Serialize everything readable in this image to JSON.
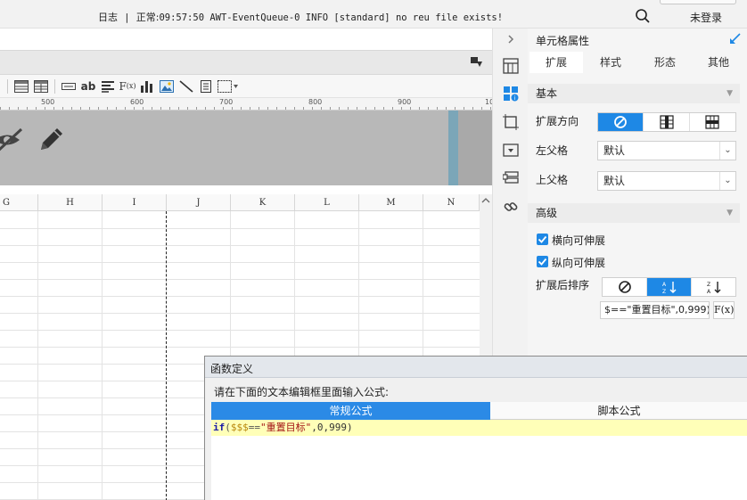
{
  "status": {
    "log_label": "日志",
    "separator": "|",
    "status_prefix": "正常:",
    "message": "09:57:50 AWT-EventQueue-0 INFO [standard] no reu file exists!"
  },
  "header": {
    "login_label": "未登录"
  },
  "ruler": {
    "labels": [
      "500",
      "600",
      "700",
      "800",
      "900",
      "10"
    ]
  },
  "grid": {
    "columns": [
      "G",
      "H",
      "I",
      "J",
      "K",
      "L",
      "M",
      "N"
    ]
  },
  "props": {
    "title": "单元格属性",
    "tabs": [
      "扩展",
      "样式",
      "形态",
      "其他"
    ],
    "active_tab": "扩展",
    "basic": {
      "heading": "基本",
      "expand_direction_label": "扩展方向",
      "left_parent_label": "左父格",
      "left_parent_value": "默认",
      "top_parent_label": "上父格",
      "top_parent_value": "默认"
    },
    "advanced": {
      "heading": "高级",
      "horizontal_expand_label": "横向可伸展",
      "horizontal_expand_checked": true,
      "vertical_expand_label": "纵向可伸展",
      "vertical_expand_checked": true,
      "sort_label": "扩展后排序",
      "formula_value": "$==\"重置目标\",0,999)",
      "fx_label": "F(x)"
    }
  },
  "dialog": {
    "title": "函数定义",
    "prompt": "请在下面的文本编辑框里面输入公式:",
    "tabs": [
      "常规公式",
      "脚本公式"
    ],
    "active_tab": "常规公式",
    "code": {
      "kw": "if",
      "open": "(",
      "var": "$$$",
      "op": "==",
      "str": "\"重置目标\"",
      "rest": ",0,999)"
    }
  },
  "colors": {
    "accent": "#1e88e5",
    "marker": "#7ba6b8",
    "code_highlight": "#ffffb8"
  }
}
